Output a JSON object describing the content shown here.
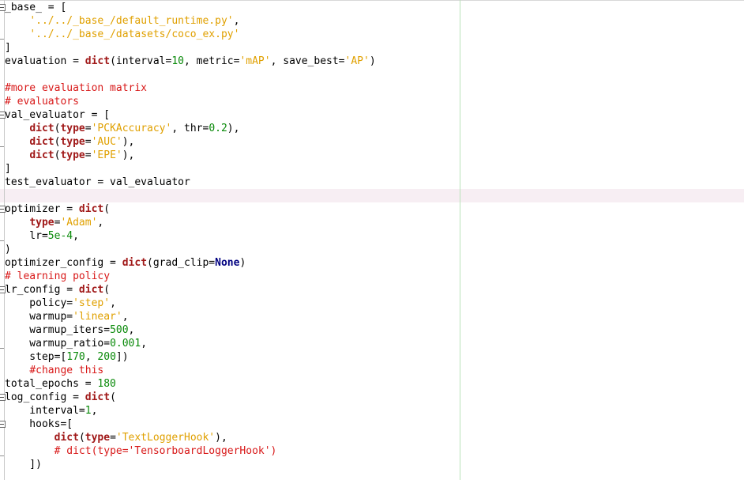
{
  "editor": {
    "current_line": 14,
    "lines": [
      [
        [
          "",
          "_base_ = ["
        ]
      ],
      [
        [
          "",
          "    "
        ],
        [
          "st",
          "'../../_base_/default_runtime.py'"
        ],
        [
          "",
          ","
        ]
      ],
      [
        [
          "",
          "    "
        ],
        [
          "st",
          "'../../_base_/datasets/coco_ex.py'"
        ]
      ],
      [
        [
          "",
          "]"
        ]
      ],
      [
        [
          "",
          "evaluation = "
        ],
        [
          "kw",
          "dict"
        ],
        [
          "",
          "(interval="
        ],
        [
          "nu",
          "10"
        ],
        [
          "",
          ", metric="
        ],
        [
          "st",
          "'mAP'"
        ],
        [
          "",
          ", save_best="
        ],
        [
          "st",
          "'AP'"
        ],
        [
          "",
          ")"
        ]
      ],
      [
        [
          "",
          ""
        ]
      ],
      [
        [
          "cm",
          "#more evaluation matrix"
        ]
      ],
      [
        [
          "cm",
          "# evaluators"
        ]
      ],
      [
        [
          "",
          "val_evaluator = ["
        ]
      ],
      [
        [
          "",
          "    "
        ],
        [
          "kw",
          "dict"
        ],
        [
          "",
          "("
        ],
        [
          "kw",
          "type"
        ],
        [
          "",
          "="
        ],
        [
          "st",
          "'PCKAccuracy'"
        ],
        [
          "",
          ", thr="
        ],
        [
          "nu",
          "0.2"
        ],
        [
          "",
          "),"
        ]
      ],
      [
        [
          "",
          "    "
        ],
        [
          "kw",
          "dict"
        ],
        [
          "",
          "("
        ],
        [
          "kw",
          "type"
        ],
        [
          "",
          "="
        ],
        [
          "st",
          "'AUC'"
        ],
        [
          "",
          "),"
        ]
      ],
      [
        [
          "",
          "    "
        ],
        [
          "kw",
          "dict"
        ],
        [
          "",
          "("
        ],
        [
          "kw",
          "type"
        ],
        [
          "",
          "="
        ],
        [
          "st",
          "'EPE'"
        ],
        [
          "",
          "),"
        ]
      ],
      [
        [
          "",
          "]"
        ]
      ],
      [
        [
          "",
          "test_evaluator = val_evaluator"
        ]
      ],
      [
        [
          "",
          ""
        ]
      ],
      [
        [
          "",
          "optimizer = "
        ],
        [
          "kw",
          "dict"
        ],
        [
          "",
          "("
        ]
      ],
      [
        [
          "",
          "    "
        ],
        [
          "kw",
          "type"
        ],
        [
          "",
          "="
        ],
        [
          "st",
          "'Adam'"
        ],
        [
          "",
          ","
        ]
      ],
      [
        [
          "",
          "    lr="
        ],
        [
          "nu",
          "5e-4"
        ],
        [
          "",
          ","
        ]
      ],
      [
        [
          "",
          ")"
        ]
      ],
      [
        [
          "",
          "optimizer_config = "
        ],
        [
          "kw",
          "dict"
        ],
        [
          "",
          "(grad_clip="
        ],
        [
          "bi",
          "None"
        ],
        [
          "",
          ")"
        ]
      ],
      [
        [
          "cm",
          "# learning policy"
        ]
      ],
      [
        [
          "",
          "lr_config = "
        ],
        [
          "kw",
          "dict"
        ],
        [
          "",
          "("
        ]
      ],
      [
        [
          "",
          "    policy="
        ],
        [
          "st",
          "'step'"
        ],
        [
          "",
          ","
        ]
      ],
      [
        [
          "",
          "    warmup="
        ],
        [
          "st",
          "'linear'"
        ],
        [
          "",
          ","
        ]
      ],
      [
        [
          "",
          "    warmup_iters="
        ],
        [
          "nu",
          "500"
        ],
        [
          "",
          ","
        ]
      ],
      [
        [
          "",
          "    warmup_ratio="
        ],
        [
          "nu",
          "0.001"
        ],
        [
          "",
          ","
        ]
      ],
      [
        [
          "",
          "    step=["
        ],
        [
          "nu",
          "170"
        ],
        [
          "",
          ", "
        ],
        [
          "nu",
          "200"
        ],
        [
          "",
          "])"
        ]
      ],
      [
        [
          "",
          "    "
        ],
        [
          "cm",
          "#change this"
        ]
      ],
      [
        [
          "",
          "total_epochs = "
        ],
        [
          "nu",
          "180"
        ]
      ],
      [
        [
          "",
          "log_config = "
        ],
        [
          "kw",
          "dict"
        ],
        [
          "",
          "("
        ]
      ],
      [
        [
          "",
          "    interval="
        ],
        [
          "nu",
          "1"
        ],
        [
          "",
          ","
        ]
      ],
      [
        [
          "",
          "    hooks=["
        ]
      ],
      [
        [
          "",
          "        "
        ],
        [
          "kw",
          "dict"
        ],
        [
          "",
          "("
        ],
        [
          "kw",
          "type"
        ],
        [
          "",
          "="
        ],
        [
          "st",
          "'TextLoggerHook'"
        ],
        [
          "",
          "),"
        ]
      ],
      [
        [
          "",
          "        "
        ],
        [
          "cm",
          "# dict(type='TensorboardLoggerHook')"
        ]
      ],
      [
        [
          "",
          "    ])"
        ]
      ]
    ],
    "fold_open_lines": [
      0,
      8,
      15,
      21,
      29,
      31
    ],
    "fold_end_lines": [
      3,
      11,
      18,
      26,
      34
    ]
  },
  "colors": {
    "keyword": "#a01818",
    "string": "#e0a000",
    "number": "#0a8a0a",
    "comment": "#d81818",
    "builtin_constant": "#000080",
    "current_line_bg": "#f7eef3",
    "margin_line": "#b9e2b9"
  }
}
